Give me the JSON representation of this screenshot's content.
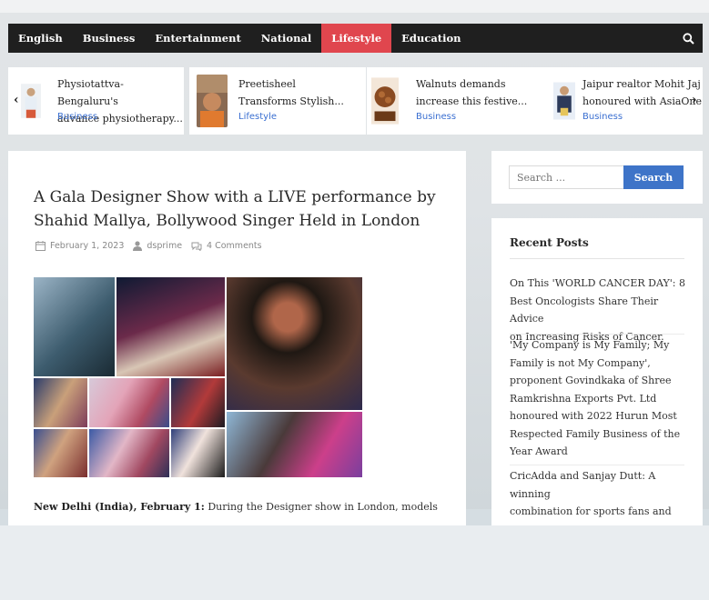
{
  "nav": {
    "items": [
      "English",
      "Business",
      "Entertainment",
      "National",
      "Lifestyle",
      "Education"
    ],
    "active": "Lifestyle",
    "search_icon": "search-icon"
  },
  "ticker": {
    "prev_icon": "chevron-left-icon",
    "next_icon": "chevron-right-icon",
    "cards": [
      {
        "title_l1": "Physiotattva- Bengaluru's",
        "title_l2": "advance physiotherapy...",
        "category": "Business"
      },
      {
        "title_l1": "Preetisheel",
        "title_l2": "Transforms Stylish...",
        "category": "Lifestyle"
      },
      {
        "title_l1": "Walnuts demands",
        "title_l2": "increase this festive...",
        "category": "Business"
      },
      {
        "title_l1": "Jaipur realtor Mohit Jaj",
        "title_l2": "honoured with AsiaOne",
        "category": "Business"
      }
    ]
  },
  "article": {
    "title": "A Gala Designer Show with a LIVE performance by Shahid Mallya, Bollywood Singer Held in London",
    "date": "February 1, 2023",
    "author": "dsprime",
    "comments": "4 Comments",
    "intro_bold": "New Delhi (India), February 1:",
    "intro_text": " During the Designer show in London, models"
  },
  "sidebar": {
    "search_placeholder": "Search ...",
    "search_button": "Search",
    "recent_heading": "Recent Posts",
    "recent_posts": [
      {
        "lines": [
          "On This 'WORLD CANCER DAY': 8",
          "Best Oncologists Share Their Advice",
          "on Increasing Risks of Cancer."
        ]
      },
      {
        "lines": [
          "'My Company is My Family; My",
          "Family is not My Company',",
          "proponent Govindkaka of Shree",
          "Ramkrishna Exports Pvt. Ltd",
          "honoured with 2022 Hurun Most",
          "Respected Family Business of the",
          "Year Award"
        ]
      },
      {
        "lines": [
          "CricAdda and Sanjay Dutt: A winning",
          "combination for sports fans and"
        ]
      }
    ]
  },
  "colors": {
    "nav_bg": "#1f1f1f",
    "nav_active": "#e0464e",
    "link_blue": "#3a6fd1",
    "button_blue": "#3e74c8"
  }
}
